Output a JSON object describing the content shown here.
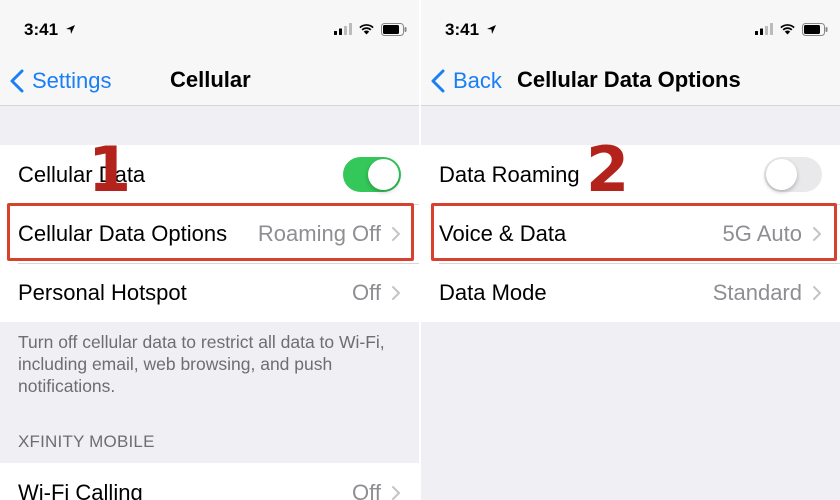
{
  "status_bar": {
    "time": "3:41"
  },
  "left": {
    "nav": {
      "back_label": "Settings",
      "title": "Cellular"
    },
    "rows": [
      {
        "label": "Cellular Data",
        "toggle": "on"
      },
      {
        "label": "Cellular Data Options",
        "value": "Roaming Off"
      },
      {
        "label": "Personal Hotspot",
        "value": "Off"
      }
    ],
    "footer": "Turn off cellular data to restrict all data to Wi-Fi, including email, web browsing, and push notifications.",
    "section_header": "XFINITY MOBILE",
    "section_rows": [
      {
        "label": "Wi-Fi Calling",
        "value": "Off"
      }
    ],
    "step_number": "1"
  },
  "right": {
    "nav": {
      "back_label": "Back",
      "title": "Cellular Data Options"
    },
    "rows": [
      {
        "label": "Data Roaming",
        "toggle": "off"
      },
      {
        "label": "Voice & Data",
        "value": "5G Auto"
      },
      {
        "label": "Data Mode",
        "value": "Standard"
      }
    ],
    "step_number": "2"
  },
  "colors": {
    "accent": "#1a7ef5",
    "toggle_on": "#34c759",
    "highlight": "#d9412f",
    "step_number": "#b3231c"
  }
}
